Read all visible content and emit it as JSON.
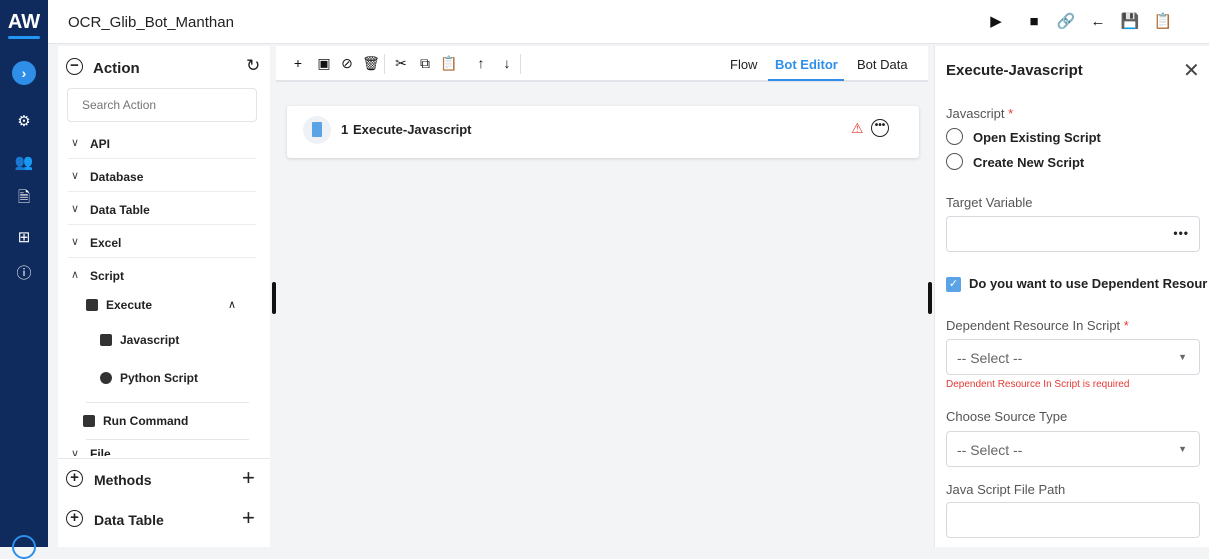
{
  "app": {
    "logo": "AW",
    "title": "OCR_Glib_Bot_Manthan"
  },
  "rail": {
    "icons": [
      "chevron-right-icon",
      "settings-cog-icon",
      "users-icon",
      "file-cog-icon",
      "apps-grid-icon",
      "info-icon"
    ],
    "accent": "#2f8fe8",
    "background": "#0f2a5c"
  },
  "topbar": {
    "icons": [
      "play-icon",
      "video-icon",
      "link-icon",
      "back-arrow-icon",
      "save-icon",
      "export-icon"
    ]
  },
  "actions_panel": {
    "header": "Action",
    "search_placeholder": "Search Action",
    "categories": [
      {
        "label": "API",
        "expanded": false
      },
      {
        "label": "Database",
        "expanded": false
      },
      {
        "label": "Data Table",
        "expanded": false
      },
      {
        "label": "Excel",
        "expanded": false
      },
      {
        "label": "Script",
        "expanded": true
      }
    ],
    "script_group": {
      "label": "Execute",
      "items": [
        "Javascript",
        "Python Script"
      ]
    },
    "run_command": "Run Command",
    "partial_next": "File",
    "footer": [
      {
        "label": "Methods"
      },
      {
        "label": "Data Table"
      }
    ]
  },
  "editor": {
    "tabs": [
      "Flow",
      "Bot Editor",
      "Bot Data"
    ],
    "active_tab": "Bot Editor",
    "steps": [
      {
        "number": "1",
        "name": "Execute-Javascript",
        "warning": true
      }
    ]
  },
  "properties": {
    "title": "Execute-Javascript",
    "javascript_label": "Javascript",
    "required_mark": "*",
    "radio_options": [
      "Open Existing Script",
      "Create New Script"
    ],
    "target_variable_label": "Target Variable",
    "target_variable_value": "",
    "dependent_checkbox_label": "Do you want to use Dependent Resour",
    "dependent_checked": true,
    "dependent_resource_label": "Dependent Resource In Script",
    "dependent_resource_placeholder": "-- Select --",
    "dependent_resource_error": "Dependent Resource In Script is required",
    "source_type_label": "Choose Source Type",
    "source_type_placeholder": "-- Select --",
    "file_path_label": "Java Script File Path",
    "file_path_value": ""
  }
}
